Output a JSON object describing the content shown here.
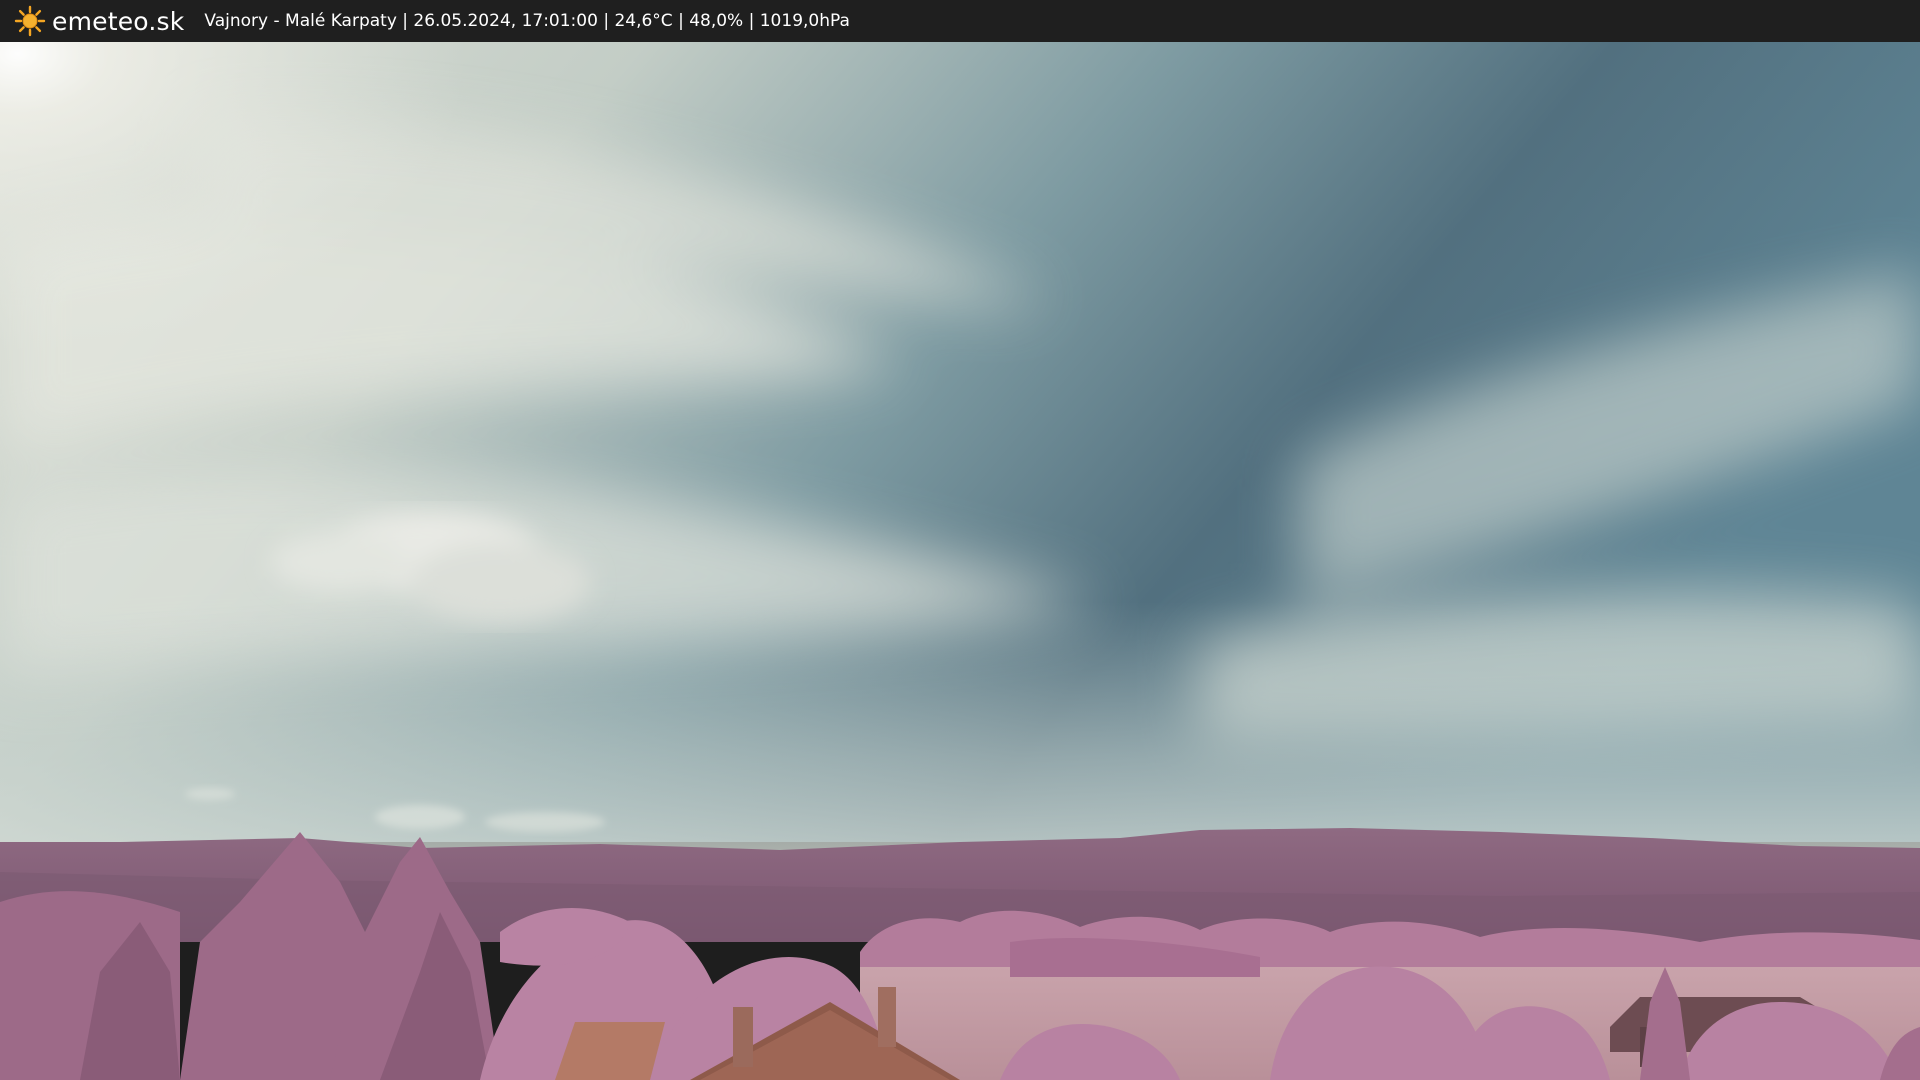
{
  "header": {
    "brand": "emeteo.sk",
    "caption": "Vajnory - Malé Karpaty | 26.05.2024, 17:01:00 | 24,6°C | 48,0% | 1019,0hPa"
  },
  "icons": {
    "brand_icon": "sun-icon"
  },
  "colors": {
    "bar_background": "#1f1f1f",
    "bar_text": "#ffffff",
    "sun": "#f5a623",
    "sky_blue": "#4f7f94",
    "foliage_pink": "#b77a9c"
  }
}
